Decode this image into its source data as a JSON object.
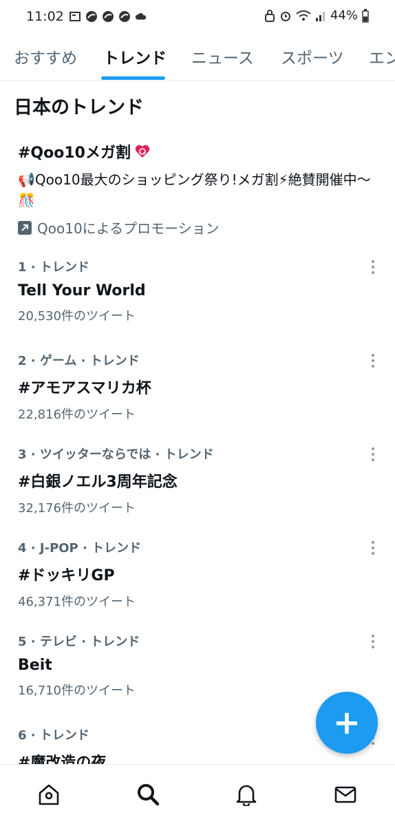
{
  "status_bar": {
    "time": "11:02",
    "battery": "44%"
  },
  "tabs": [
    {
      "label": "おすすめ"
    },
    {
      "label": "トレンド"
    },
    {
      "label": "ニュース"
    },
    {
      "label": "スポーツ"
    },
    {
      "label": "エン"
    }
  ],
  "section_title": "日本のトレンド",
  "promo": {
    "title": "#Qoo10メガ割",
    "description": "📢Qoo10最大のショッピング祭り!メガ割⚡絶賛開催中〜🎊",
    "promoted_by": "Qoo10によるプロモーション"
  },
  "trends": [
    {
      "meta": "1 · トレンド",
      "name": "Tell Your World",
      "count": "20,530件のツイート"
    },
    {
      "meta": "2 · ゲーム · トレンド",
      "name": "#アモアスマリカ杯",
      "count": "22,816件のツイート"
    },
    {
      "meta": "3 · ツイッターならでは · トレンド",
      "name": "#白銀ノエル3周年記念",
      "count": "32,176件のツイート"
    },
    {
      "meta": "4 · J-POP · トレンド",
      "name": "#ドッキリGP",
      "count": "46,371件のツイート"
    },
    {
      "meta": "5 · テレビ · トレンド",
      "name": "Beit",
      "count": "16,710件のツイート"
    },
    {
      "meta": "6 · トレンド",
      "name": "#魔改造の夜",
      "count": ""
    }
  ],
  "fab": {
    "symbol": "+"
  },
  "colors": {
    "accent": "#1d9bf0",
    "secondary_text": "#536471",
    "primary_text": "#0f1419"
  },
  "bottom_nav": [
    {
      "icon": "home-icon"
    },
    {
      "icon": "search-icon"
    },
    {
      "icon": "bell-icon"
    },
    {
      "icon": "mail-icon"
    }
  ]
}
